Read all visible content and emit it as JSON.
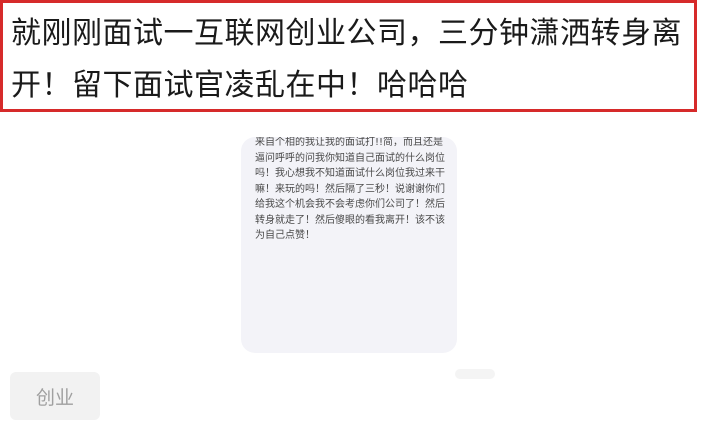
{
  "headline": "就刚刚面试一互联网创业公司，三分钟潇洒转身离开！留下面试官凌乱在中！哈哈哈",
  "note": {
    "text": "来自个相的我让我的面试打!!简，而且还是逼问呼呼的问我你知道自己面试的什么岗位吗！我心想我不知道面试什么岗位我过来干嘛！来玩的吗！然后隔了三秒！说谢谢你们给我这个机会我不会考虑你们公司了！然后转身就走了！然后傻眼的看我离开！该不该为自己点赞！"
  },
  "tag": {
    "label": "创业"
  },
  "colors": {
    "frame_border": "#d62a2a",
    "card_bg": "#f3f3f8",
    "tag_bg": "#f2f2f2",
    "tag_text": "#a0a0a0"
  }
}
